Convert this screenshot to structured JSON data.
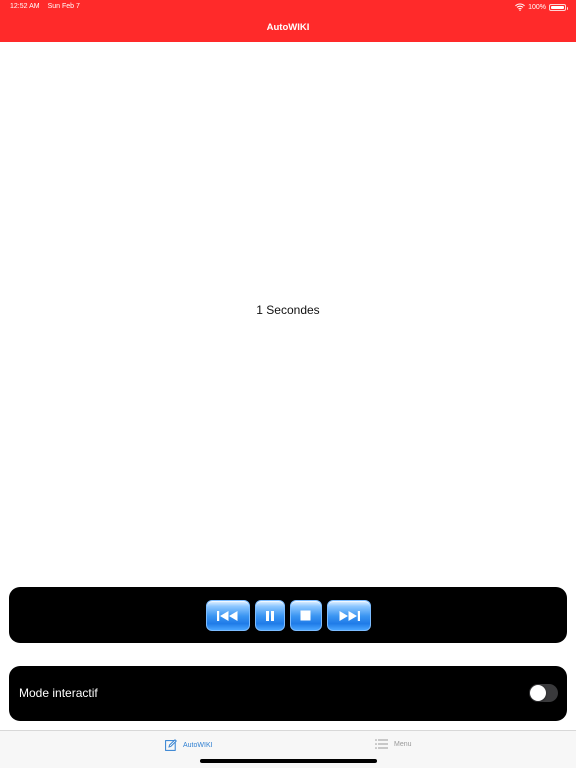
{
  "status_bar": {
    "time": "12:52 AM",
    "date": "Sun Feb 7",
    "battery": "100%",
    "battery_level": 1.0,
    "icons": [
      "wifi-icon",
      "battery-icon"
    ]
  },
  "nav": {
    "title": "AutoWIKI"
  },
  "main": {
    "timer_text": "1 Secondes"
  },
  "player": {
    "buttons": [
      {
        "name": "previous-button",
        "icon": "skip-back-icon"
      },
      {
        "name": "pause-button",
        "icon": "pause-icon"
      },
      {
        "name": "stop-button",
        "icon": "stop-icon"
      },
      {
        "name": "next-button",
        "icon": "skip-forward-icon"
      }
    ]
  },
  "interactive_mode": {
    "label": "Mode interactif",
    "enabled": false
  },
  "tab_bar": {
    "items": [
      {
        "label": "AutoWIKI",
        "icon": "edit-icon",
        "selected": true
      },
      {
        "label": "Menu",
        "icon": "list-icon",
        "selected": false
      }
    ]
  },
  "colors": {
    "header": "#ff2a2a",
    "accent": "#2f7fd1",
    "panel": "#000000"
  }
}
